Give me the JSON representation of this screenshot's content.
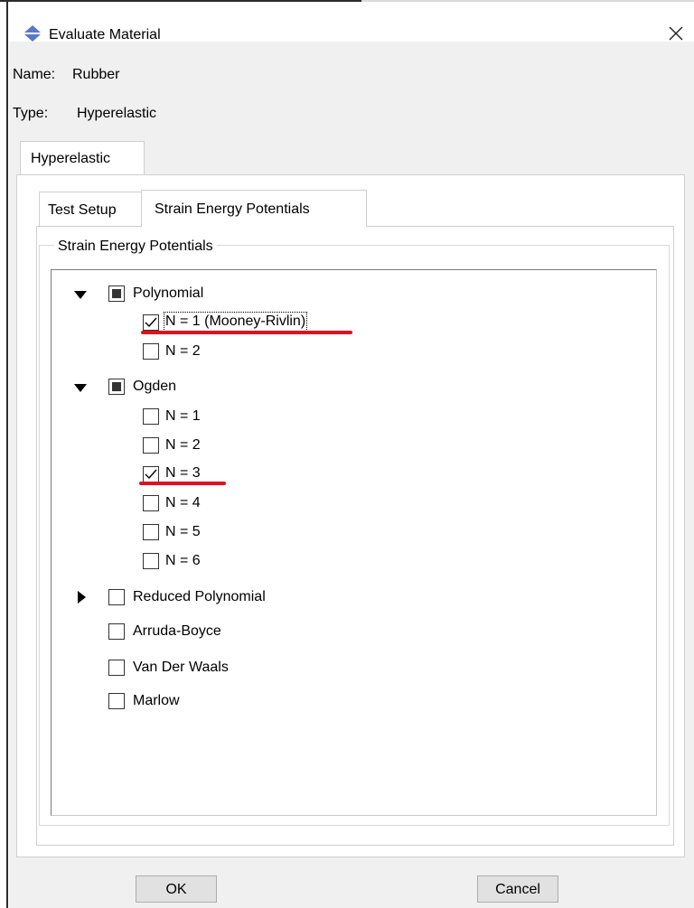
{
  "window": {
    "title": "Evaluate Material",
    "close_glyph": "✕",
    "icon": "double-arrow-app-icon"
  },
  "fields": {
    "name_label": "Name:",
    "name_value": "Rubber",
    "type_label": "Type:",
    "type_value": "Hyperelastic"
  },
  "outer_tabs": [
    {
      "label": "Hyperelastic",
      "selected": true
    }
  ],
  "inner_tabs": [
    {
      "label": "Test Setup",
      "selected": false
    },
    {
      "label": "Strain Energy Potentials",
      "selected": true
    }
  ],
  "group": {
    "title": "Strain Energy Potentials"
  },
  "tree": {
    "polynomial": {
      "label": "Polynomial",
      "state": "partial",
      "expanded": true,
      "children": [
        {
          "label": "N = 1 (Mooney-Rivlin)",
          "checked": true,
          "focused": true
        },
        {
          "label": "N = 2",
          "checked": false
        }
      ]
    },
    "ogden": {
      "label": "Ogden",
      "state": "partial",
      "expanded": true,
      "children": [
        {
          "label": "N = 1",
          "checked": false
        },
        {
          "label": "N = 2",
          "checked": false
        },
        {
          "label": "N = 3",
          "checked": true
        },
        {
          "label": "N = 4",
          "checked": false
        },
        {
          "label": "N = 5",
          "checked": false
        },
        {
          "label": "N = 6",
          "checked": false
        }
      ]
    },
    "reduced_polynomial": {
      "label": "Reduced Polynomial",
      "state": "unchecked",
      "expanded": false
    },
    "arruda_boyce": {
      "label": "Arruda-Boyce",
      "checked": false
    },
    "van_der_waals": {
      "label": "Van Der Waals",
      "checked": false
    },
    "marlow": {
      "label": "Marlow",
      "checked": false
    }
  },
  "annotations": {
    "underline_color": "#e0101f"
  },
  "buttons": {
    "ok": "OK",
    "cancel": "Cancel"
  }
}
